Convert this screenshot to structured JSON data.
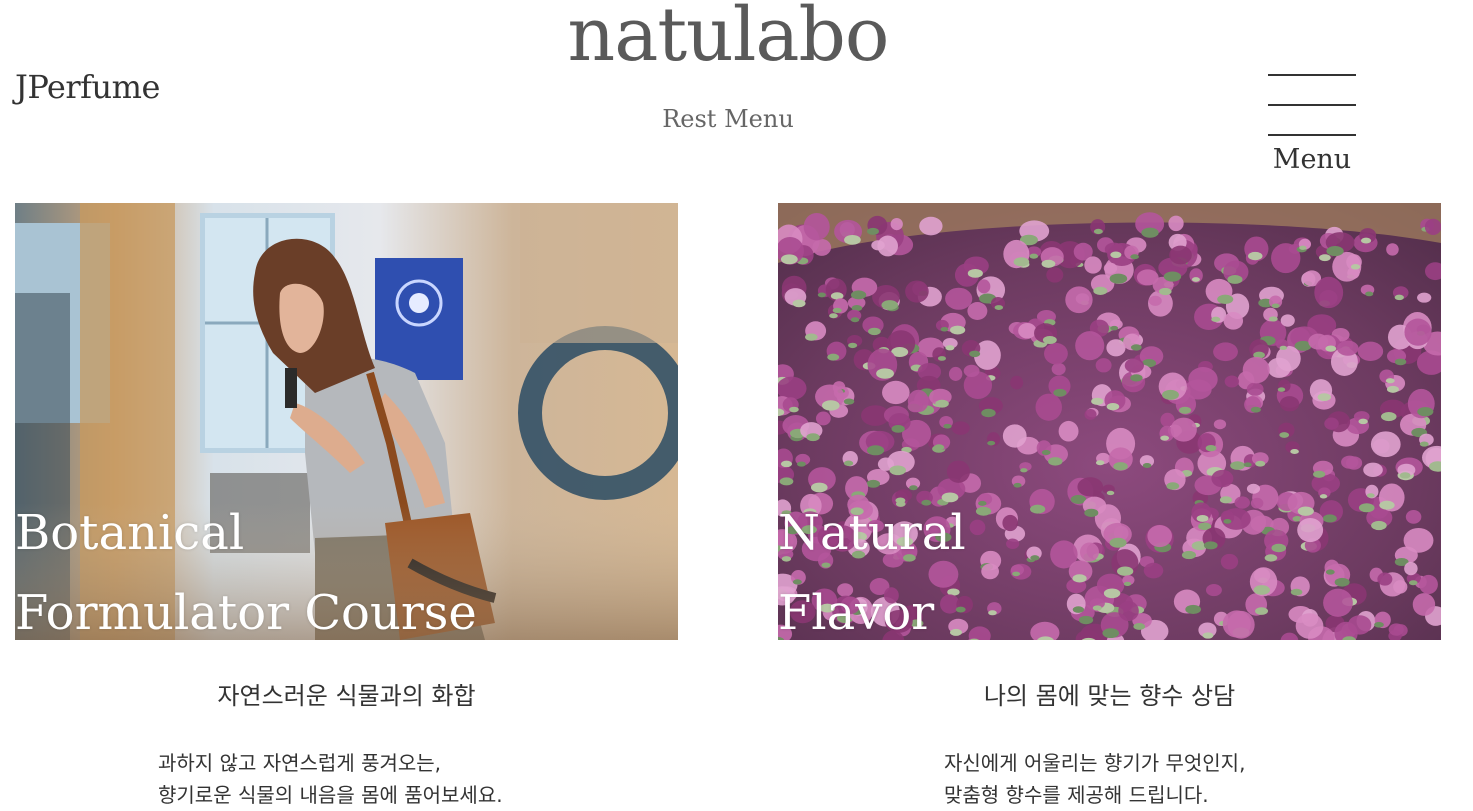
{
  "header": {
    "brand": "JPerfume",
    "logo": "natulabo",
    "subtitle": "Rest Menu",
    "menu_label": "Menu"
  },
  "cards": [
    {
      "title_line1": "Botanical",
      "title_line2": "Formulator Course",
      "subtitle": "자연스러운 식물과의 화합",
      "body_line1": "과하지 않고 자연스럽게 풍겨오는,",
      "body_line2": "향기로운 식물의 내음을 몸에 품어보세요."
    },
    {
      "title_line1": "Natural",
      "title_line2": "Flavor",
      "subtitle": "나의 몸에 맞는 향수 상담",
      "body_line1": "자신에게 어울리는 향기가 무엇인지,",
      "body_line2": "맞춤형 향수를 제공해 드립니다."
    }
  ],
  "colors": {
    "logo": "#5a5a5a",
    "text": "#333333",
    "overlay_text": "#ffffff",
    "petal_purple": "#a04a8c",
    "petal_green": "#8aa878"
  },
  "icons": {
    "menu": "hamburger-icon"
  }
}
